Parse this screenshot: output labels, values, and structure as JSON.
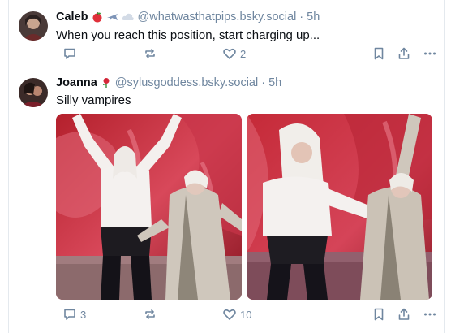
{
  "posts": [
    {
      "author": "Caleb",
      "emojis": [
        "apple-emoji",
        "airplane-emoji",
        "cloud-emoji"
      ],
      "handle": "@whatwasthatpips.bsky.social",
      "separator": "·",
      "time": "5h",
      "text": "When you reach this position, start charging up...",
      "replies": "",
      "reposts": "",
      "likes": "2"
    },
    {
      "author": "Joanna",
      "emojis": [
        "rose-emoji"
      ],
      "handle": "@sylusgoddess.bsky.social",
      "separator": "·",
      "time": "5h",
      "text": "Silly vampires",
      "replies": "3",
      "reposts": "",
      "likes": "10",
      "images": [
        "image-vampires-left",
        "image-vampires-right"
      ]
    }
  ],
  "colors": {
    "text": "#0b0f14",
    "muted": "#6f869f",
    "divider": "#e4e9ee"
  }
}
